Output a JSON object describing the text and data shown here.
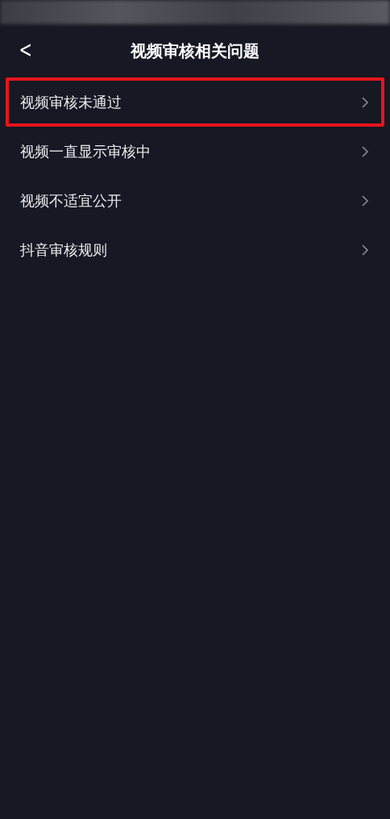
{
  "header": {
    "back": "<",
    "title": "视频审核相关问题"
  },
  "items": [
    {
      "label": "视频审核未通过",
      "highlighted": true
    },
    {
      "label": "视频一直显示审核中",
      "highlighted": false
    },
    {
      "label": "视频不适宜公开",
      "highlighted": false
    },
    {
      "label": "抖音审核规则",
      "highlighted": false
    }
  ]
}
